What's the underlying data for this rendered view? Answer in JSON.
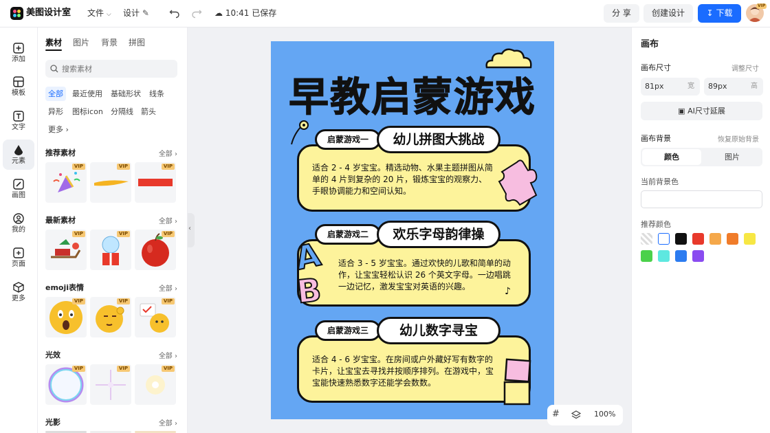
{
  "app": {
    "name": "美图设计室"
  },
  "topbar": {
    "file_menu": "文件",
    "design_menu": "设计",
    "save_status": "10:41 已保存",
    "share_label": "分 享",
    "create_label": "创建设计",
    "download_label": "下载",
    "avatar_badge": "VIP"
  },
  "rail": {
    "items": [
      {
        "label": "添加",
        "icon": "plus-square-icon"
      },
      {
        "label": "模板",
        "icon": "template-icon"
      },
      {
        "label": "文字",
        "icon": "text-icon"
      },
      {
        "label": "元素",
        "icon": "element-icon"
      },
      {
        "label": "画图",
        "icon": "draw-icon"
      },
      {
        "label": "我的",
        "icon": "user-icon"
      },
      {
        "label": "页面",
        "icon": "page-add-icon"
      },
      {
        "label": "更多",
        "icon": "cube-icon"
      }
    ],
    "active": "元素"
  },
  "assets": {
    "tabs": [
      "素材",
      "图片",
      "背景",
      "拼图"
    ],
    "search_placeholder": "搜索素材",
    "chips": [
      "全部",
      "最近使用",
      "基础形状",
      "线条",
      "异形",
      "图标icon",
      "分隔线",
      "箭头",
      "更多"
    ],
    "vip_label": "VIP",
    "sections": [
      {
        "title": "推荐素材",
        "all": "全部"
      },
      {
        "title": "最新素材",
        "all": "全部"
      },
      {
        "title": "emoji表情",
        "all": "全部"
      },
      {
        "title": "光效",
        "all": "全部"
      },
      {
        "title": "光影",
        "all": "全部"
      }
    ]
  },
  "poster": {
    "title": "早教启蒙游戏",
    "bg_color": "#64a6f3",
    "box_color": "#fdf39b",
    "games": [
      {
        "tag": "启蒙游戏一",
        "name": "幼儿拼图大挑战",
        "desc": "适合 2 - 4 岁宝宝。精选动物、水果主题拼图从简单的 4 片到复杂的 20 片，锻炼宝宝的观察力、手眼协调能力和空间认知。"
      },
      {
        "tag": "启蒙游戏二",
        "name": "欢乐字母韵律操",
        "desc": "适合 3 - 5 岁宝宝。通过欢快的儿歌和简单的动作，让宝宝轻松认识 26 个英文字母。一边唱跳一边记忆，激发宝宝对英语的兴趣。"
      },
      {
        "tag": "启蒙游戏三",
        "name": "幼儿数字寻宝",
        "desc": "适合 4 - 6 岁宝宝。在房间或户外藏好写有数字的卡片，让宝宝去寻找并按顺序排列。在游戏中，宝宝能快速熟悉数字还能学会数数。"
      }
    ],
    "letters": [
      "A",
      "B"
    ]
  },
  "zoom": {
    "value": "100%"
  },
  "props": {
    "title": "画布",
    "size_title": "画布尺寸",
    "size_link": "调整尺寸",
    "width_value": "81px",
    "width_unit": "宽",
    "height_value": "89px",
    "height_unit": "高",
    "ai_extend": "AI尺寸延展",
    "bg_title": "画布背景",
    "bg_reset": "恢复原始背景",
    "seg_color": "颜色",
    "seg_image": "图片",
    "current_bg": "当前背景色",
    "recommend": "推荐颜色",
    "colors": [
      "transparent",
      "#ffffff",
      "#111111",
      "#e8392b",
      "#f5a84a",
      "#f07c2a",
      "#f7e744",
      "#4bd14b",
      "#5ee8e0",
      "#2c7cf0",
      "#8a4cf0"
    ]
  }
}
